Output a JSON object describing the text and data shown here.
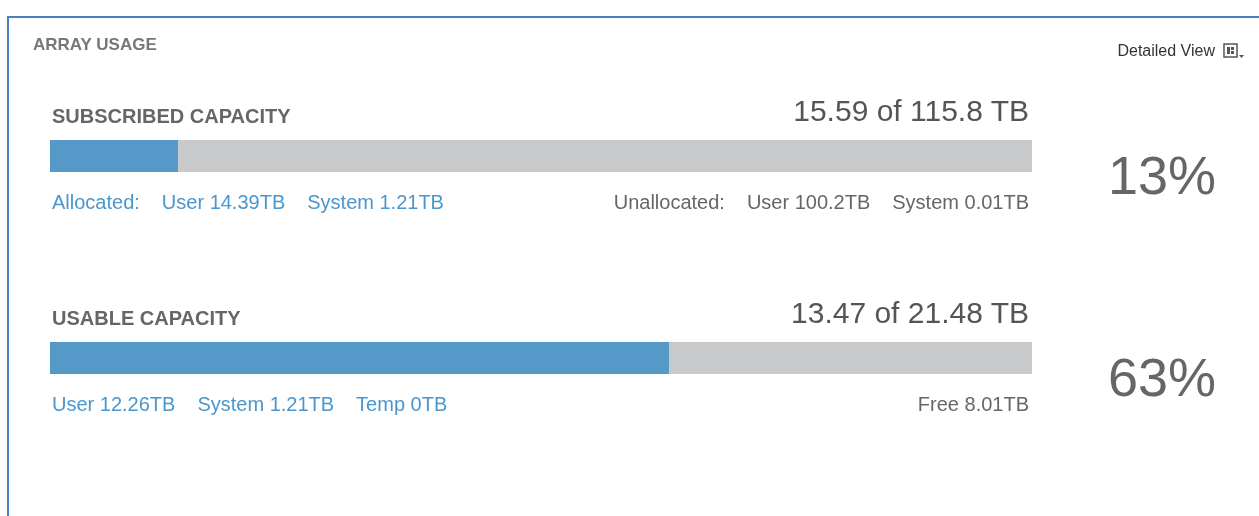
{
  "panel": {
    "title": "ARRAY USAGE",
    "view_menu": {
      "label": "Detailed View"
    }
  },
  "sections": [
    {
      "label": "SUBSCRIBED CAPACITY",
      "total": "15.59 of 115.8 TB",
      "level": 0.13,
      "percent": "13%",
      "legend_groups": [
        {
          "items": [
            {
              "text": "Allocated:",
              "color": "#4a96cf"
            },
            {
              "text": "User 14.39TB",
              "color": "#4a96cf"
            },
            {
              "text": "System 1.21TB",
              "color": "#4a96cf"
            }
          ]
        },
        {
          "items": [
            {
              "text": "Unallocated:",
              "color": "#666666"
            },
            {
              "text": "User 100.2TB",
              "color": "#666666"
            },
            {
              "text": "System 0.01TB",
              "color": "#666666"
            }
          ]
        }
      ]
    },
    {
      "label": "USABLE CAPACITY",
      "total": "13.47 of 21.48 TB",
      "level": 0.63,
      "percent": "63%",
      "legend_groups": [
        {
          "items": [
            {
              "text": "User 12.26TB",
              "color": "#4a96cf"
            },
            {
              "text": "System 1.21TB",
              "color": "#4a96cf"
            },
            {
              "text": "Temp 0TB",
              "color": "#4a96cf"
            }
          ]
        },
        {
          "items": [
            {
              "text": "Free 8.01TB",
              "color": "#666666"
            }
          ]
        }
      ]
    }
  ]
}
